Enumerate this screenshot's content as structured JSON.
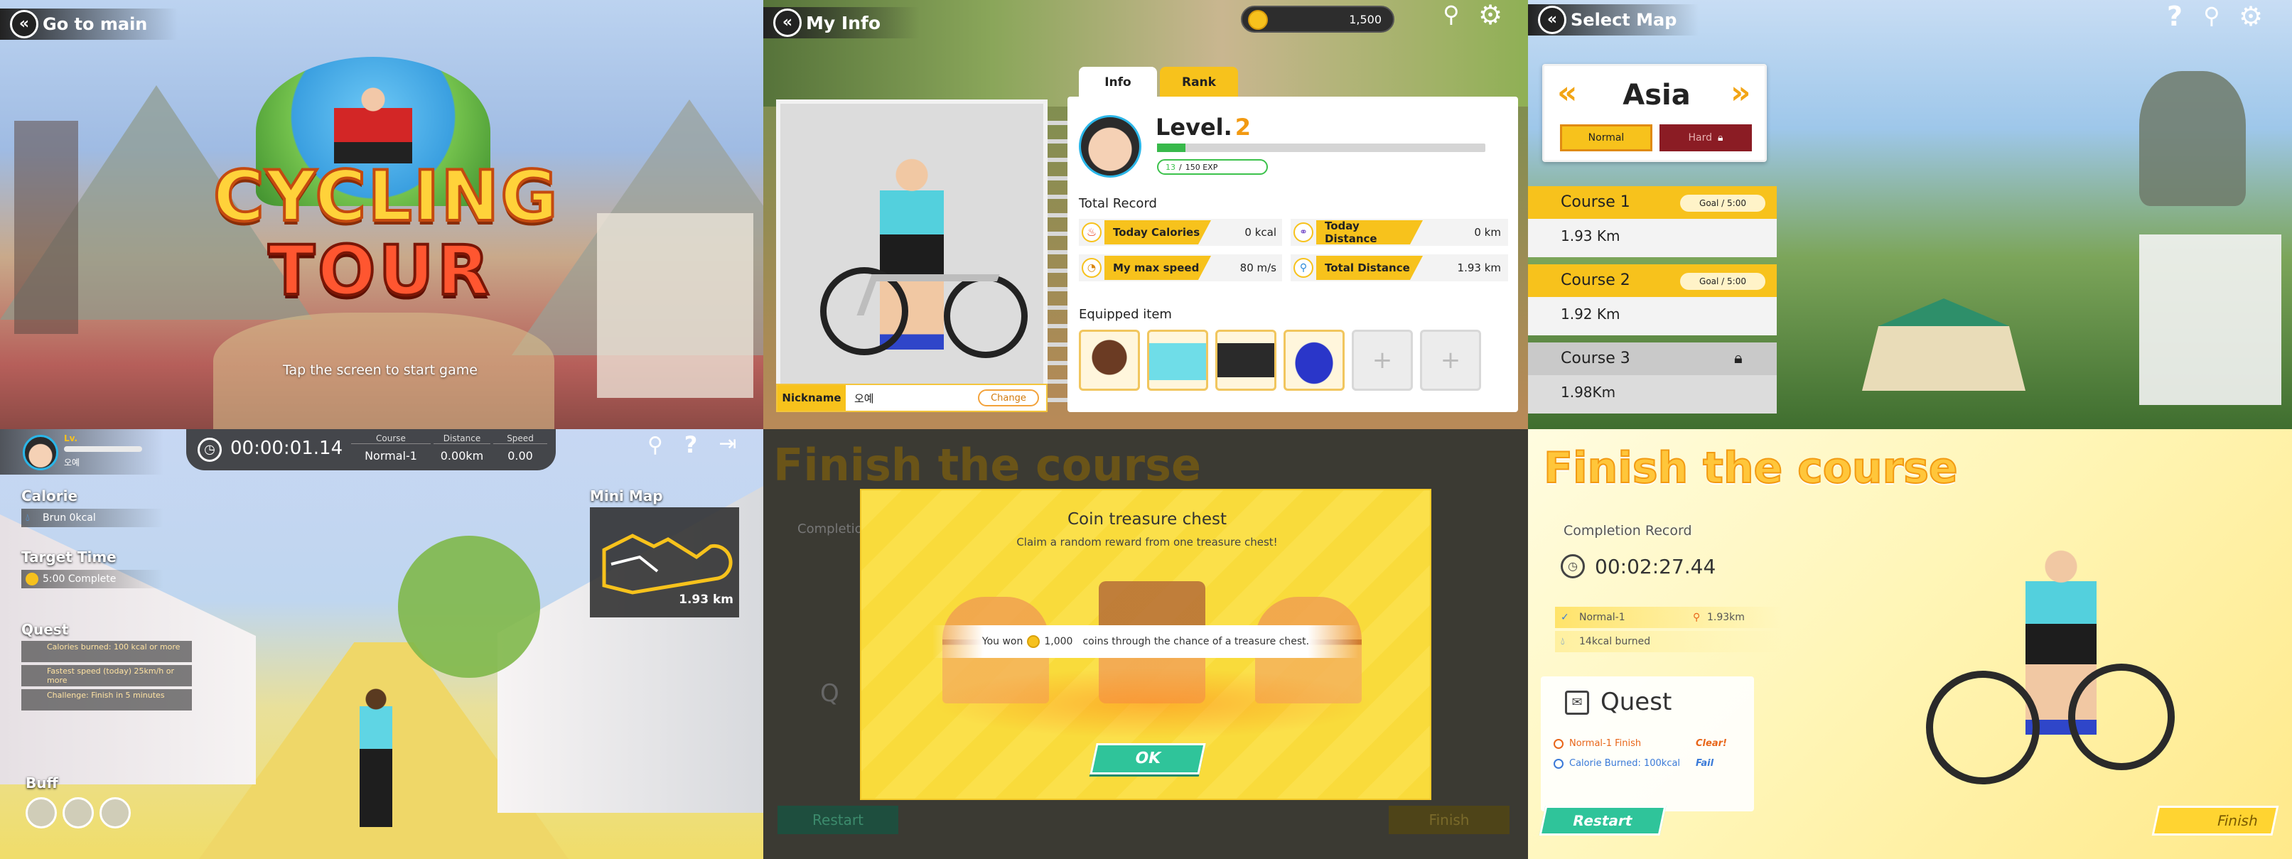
{
  "title_screen": {
    "back_label": "Go to main",
    "logo_line1": "CYCLING",
    "logo_line2": "TOUR",
    "tap_hint": "Tap the screen to start game"
  },
  "my_info": {
    "back_label": "My Info",
    "coins": "1,500",
    "tabs": [
      "Info",
      "Rank"
    ],
    "level_prefix": "Level.",
    "level_value": "2",
    "exp_current": "13",
    "exp_separator": "/",
    "exp_total": "150 EXP",
    "exp_fraction": 0.087,
    "total_record_title": "Total Record",
    "records": [
      {
        "label": "Today Calories",
        "value": "0 kcal",
        "icon": "flame-icon"
      },
      {
        "label": "Today Distance",
        "value": "0 km",
        "icon": "bike-icon"
      },
      {
        "label": "My max speed",
        "value": "80 m/s",
        "icon": "speedometer-icon"
      },
      {
        "label": "Total Distance",
        "value": "1.93 km",
        "icon": "pin-icon"
      }
    ],
    "equipped_title": "Equipped item",
    "equipped_items": [
      "helmet-icon",
      "jersey-icon",
      "shorts-icon",
      "shoes-icon"
    ],
    "empty_slot_glyph": "+",
    "nickname_label": "Nickname",
    "nickname_value": "오예",
    "change_label": "Change"
  },
  "select_map": {
    "back_label": "Select Map",
    "region": "Asia",
    "difficulty_normal": "Normal",
    "difficulty_hard": "Hard",
    "courses": [
      {
        "name": "Course 1",
        "goal": "Goal / 5:00",
        "distance": "1.93 Km",
        "locked": false
      },
      {
        "name": "Course 2",
        "goal": "Goal / 5:00",
        "distance": "1.92 Km",
        "locked": false
      },
      {
        "name": "Course 3",
        "goal": "",
        "distance": "1.98Km",
        "locked": true
      }
    ]
  },
  "gameplay": {
    "level_label": "Lv.",
    "nickname": "오예",
    "timer": "00:00:01.14",
    "hud_headers": [
      "Course",
      "Distance",
      "Speed"
    ],
    "hud_values": [
      "Normal-1",
      "0.00km",
      "0.00"
    ],
    "calorie_title": "Calorie",
    "calorie_value": "Brun 0kcal",
    "target_title": "Target Time",
    "target_value": "5:00 Complete",
    "quest_title": "Quest",
    "quests": [
      "Calories burned: 100 kcal or more",
      "Fastest speed (today) 25km/h or more",
      "Challenge: Finish in 5 minutes"
    ],
    "buff_title": "Buff",
    "minimap_title": "Mini Map",
    "minimap_distance": "1.93 km"
  },
  "treasure": {
    "bg_title": "Finish the course",
    "bg_completion": "Completion",
    "bg_quest": "Q",
    "bg_restart": "Restart",
    "bg_finish": "Finish",
    "title": "Coin treasure chest",
    "subtitle": "Claim a random reward from one treasure chest!",
    "won_prefix": "You won",
    "won_amount": "1,000",
    "won_suffix": "coins through the chance of a treasure chest.",
    "ok_label": "OK"
  },
  "finish": {
    "title": "Finish the course",
    "completion_label": "Completion Record",
    "time": "00:02:27.44",
    "course": "Normal-1",
    "distance": "1.93km",
    "kcal": "14kcal burned",
    "quest_title": "Quest",
    "quests": [
      {
        "text": "Normal-1 Finish",
        "status": "Clear!"
      },
      {
        "text": "Calorie Burned: 100kcal",
        "status": "Fail"
      }
    ],
    "restart_label": "Restart",
    "finish_label": "Finish"
  },
  "colors": {
    "accent": "#f7c21c",
    "green": "#2fc49a",
    "dark": "#2a2a2a"
  }
}
